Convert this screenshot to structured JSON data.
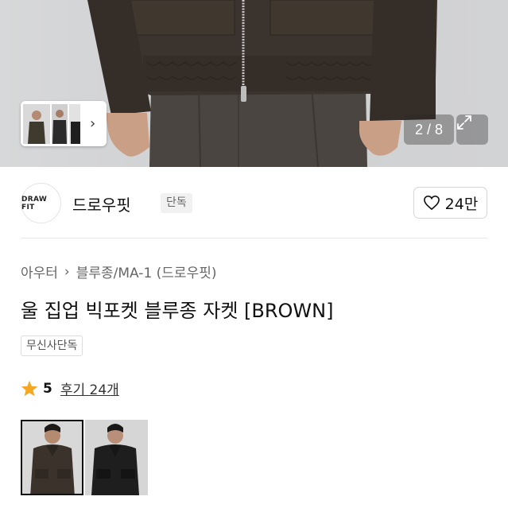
{
  "gallery": {
    "counter": "2 / 8",
    "thumb_icon": "chevron-right-icon",
    "expand_icon": "expand-icon"
  },
  "brand": {
    "logo_text": "DRAW FIT",
    "name": "드로우핏",
    "badge": "단독",
    "like_count": "24만",
    "like_icon": "heart-icon"
  },
  "product": {
    "breadcrumb": [
      "아우터",
      "블루종/MA-1 (드로우핏)"
    ],
    "title": "울 집업 빅포켓 블루종 자켓 [BROWN]",
    "exclusive_tag": "무신사단독",
    "rating": "5",
    "reviews": "후기 24개"
  },
  "colors": {
    "accent_star": "#f5a623",
    "jacket_brown": "#3a322b"
  }
}
